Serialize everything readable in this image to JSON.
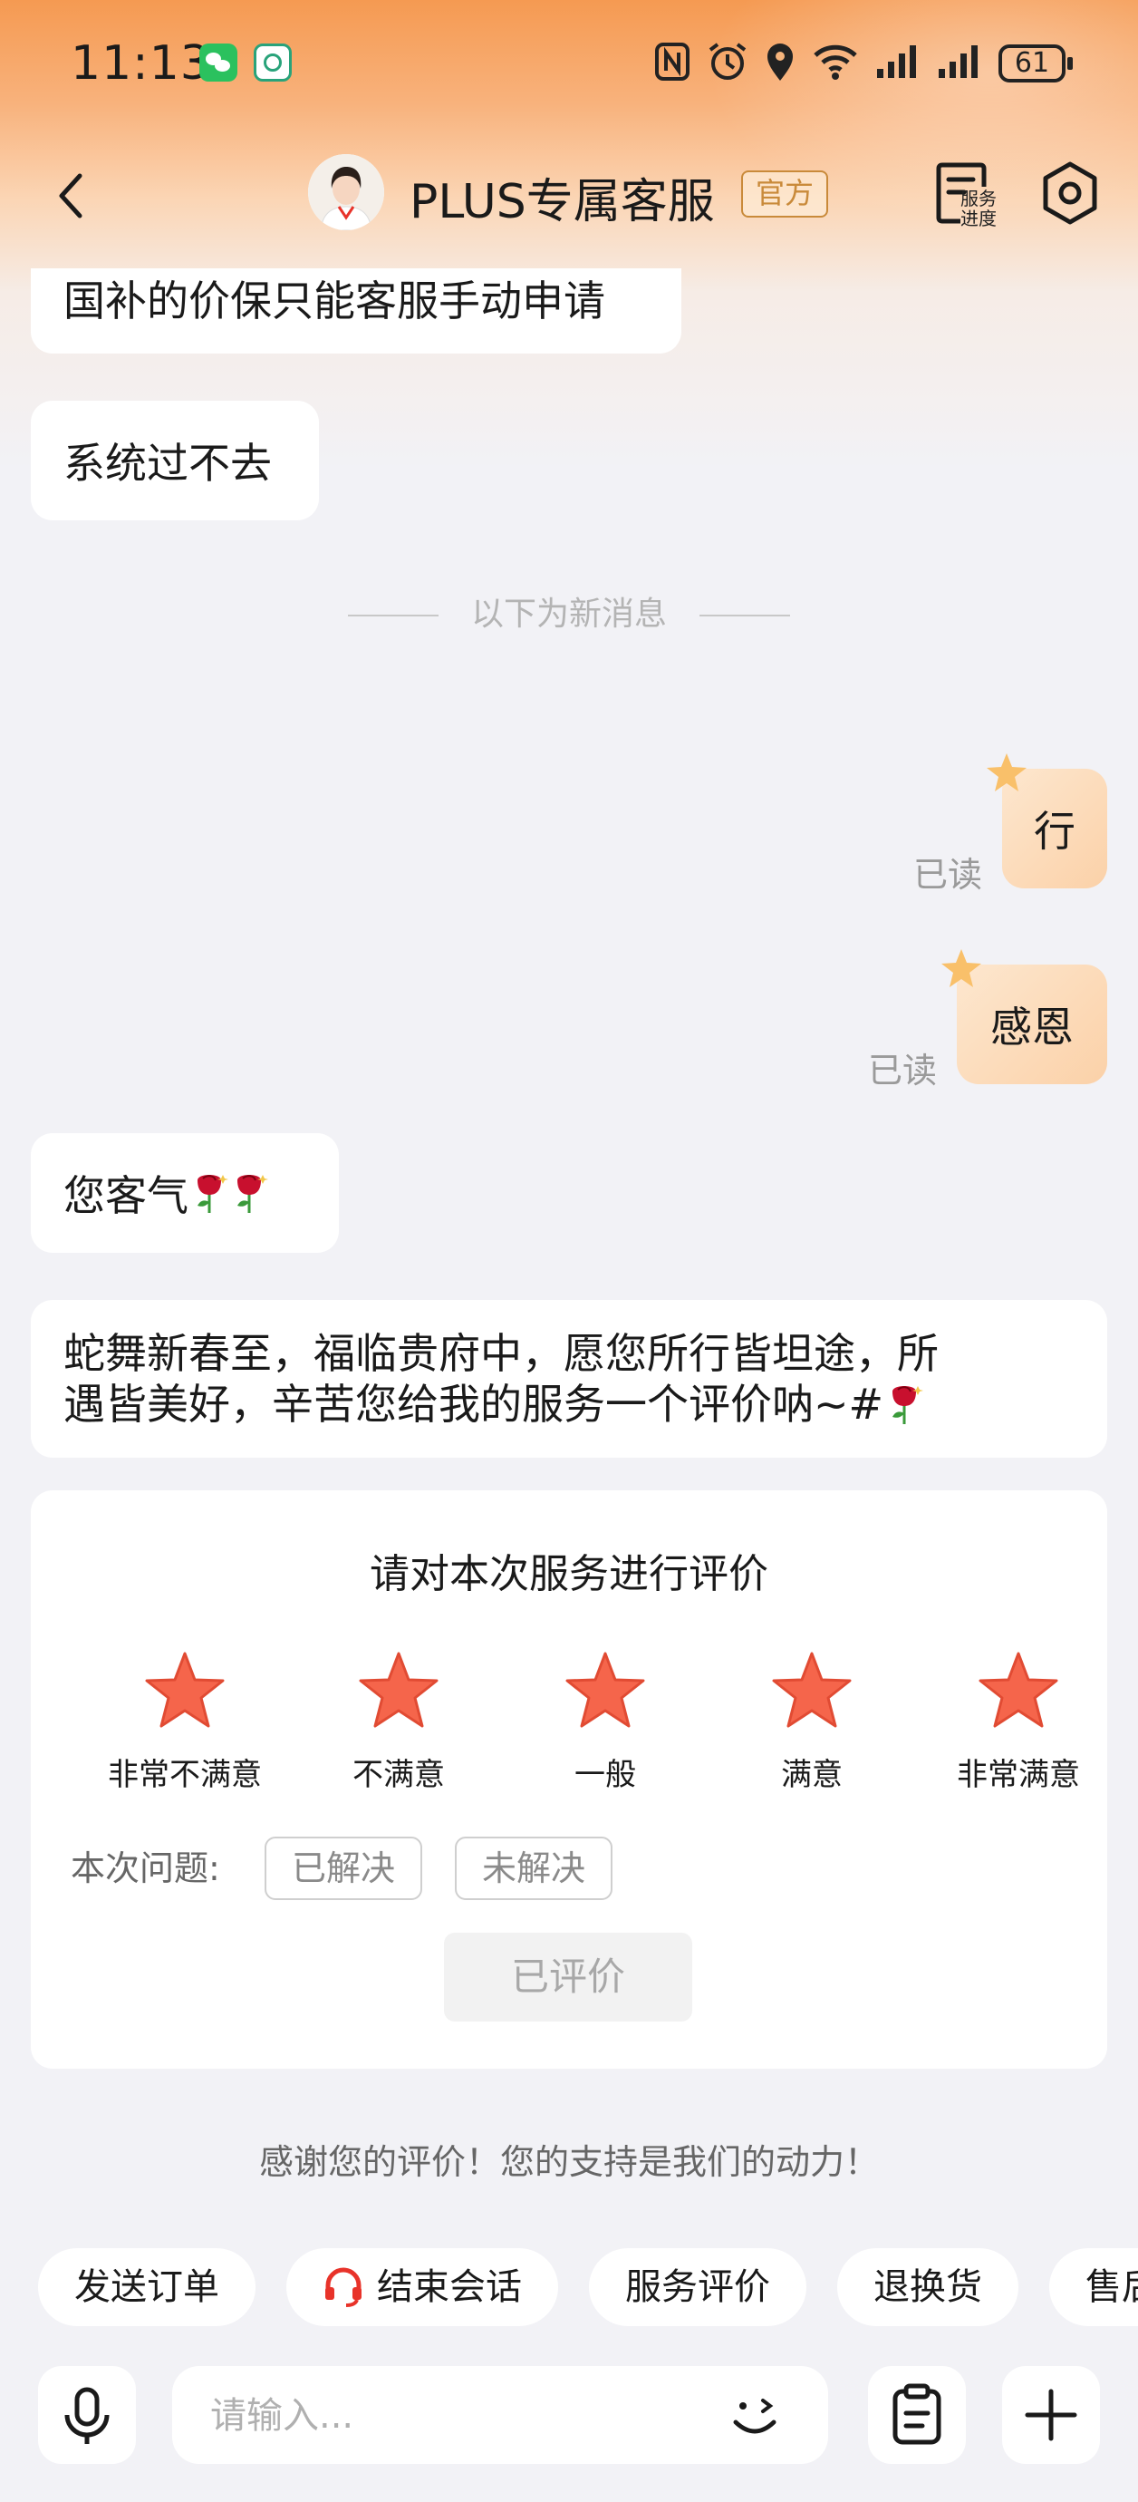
{
  "status_bar": {
    "time": "11:13",
    "battery": "61",
    "icons": [
      "wechat-icon",
      "app-notification-icon",
      "nfc-icon",
      "alarm-icon",
      "location-icon",
      "wifi-icon",
      "signal-icon",
      "signal-icon"
    ]
  },
  "header": {
    "title": "PLUS专属客服",
    "badge": "官方",
    "progress_label": "服务进度"
  },
  "messages": {
    "m1": "国补的价保只能客服手动申请",
    "m2": "系统过不去",
    "divider": "以下为新消息",
    "mine1": "行",
    "mine1_status": "已读",
    "mine2": "感恩",
    "mine2_status": "已读",
    "m3": "您客气",
    "m4_line1": "蛇舞新春至，福临贵府中，愿您所行皆坦途，所",
    "m4_line2": "遇皆美好，辛苦您给我的服务一个评价呐~#"
  },
  "rating": {
    "title": "请对本次服务进行评价",
    "options": [
      "非常不满意",
      "不满意",
      "一般",
      "满意",
      "非常满意"
    ],
    "selected_stars": 5,
    "star_color": "#f5654b",
    "issue_label": "本次问题:",
    "resolved": "已解决",
    "unresolved": "未解决",
    "submitted": "已评价"
  },
  "thanks": "感谢您的评价！您的支持是我们的动力！",
  "quick_actions": [
    "发送订单",
    "结束会话",
    "服务评价",
    "退换货",
    "售后"
  ],
  "input": {
    "placeholder": "请输入..."
  },
  "colors": {
    "accent": "#f59a52",
    "bubble_mine": "#fbd1a8",
    "headset": "#e8332a"
  }
}
